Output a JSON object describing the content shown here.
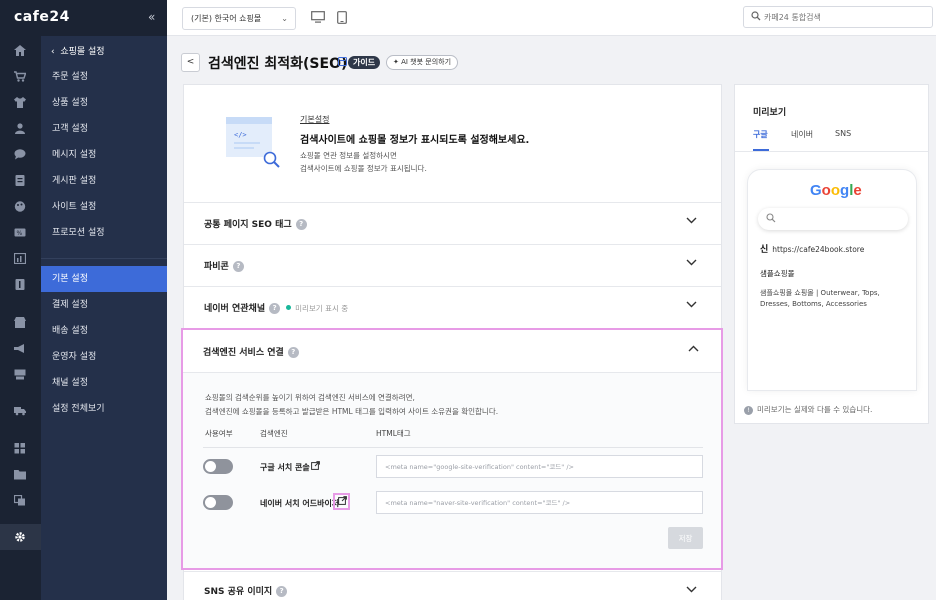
{
  "app": {
    "brand": "cafe24",
    "collapse": "«"
  },
  "menu": {
    "back_label": "쇼핑몰 설정",
    "items": [
      {
        "label": "주문 설정"
      },
      {
        "label": "상품 설정"
      },
      {
        "label": "고객 설정"
      },
      {
        "label": "메시지 설정"
      },
      {
        "label": "게시판 설정"
      },
      {
        "label": "사이트 설정"
      },
      {
        "label": "프로모션 설정"
      },
      {
        "label": "기본 설정"
      },
      {
        "label": "결제 설정"
      },
      {
        "label": "배송 설정"
      },
      {
        "label": "운영자 설정"
      },
      {
        "label": "채널 설정"
      },
      {
        "label": "설정 전체보기"
      }
    ],
    "active_index": 7
  },
  "topbar": {
    "shop_select": "(기본) 한국어 쇼핑몰",
    "search_placeholder": "카페24 통합검색"
  },
  "page": {
    "back": "<",
    "title": "검색엔진 최적화(SEO)",
    "guide_label": "가이드",
    "ai_label": "AI 챗봇 문의하기"
  },
  "intro": {
    "label": "기본설정",
    "title": "검색사이트에 쇼핑몰 정보가 표시되도록 설정해보세요.",
    "desc_line1": "쇼핑몰 연관 정보를 설정하시면",
    "desc_line2": "검색사이트에 쇼핑몰 정보가 표시됩니다."
  },
  "sections": {
    "common_seo": "공통 페이지 SEO 태그",
    "favicon": "파비콘",
    "naver_channel": "네이버 연관채널",
    "naver_channel_status": "미리보기 표시 중",
    "search_engine": "검색엔진 서비스 연결",
    "sns_image": "SNS 공유 이미지"
  },
  "search_engine": {
    "desc_line1": "쇼핑몰의 검색순위를 높이기 위하여 검색엔진 서비스에 연결하려면,",
    "desc_line2": "검색엔진에 쇼핑몰을 등록하고 발급받은 HTML 태그를 입력하여 사이트 소유권을 확인합니다.",
    "col_use": "사용여부",
    "col_engine": "검색엔진",
    "col_html": "HTML태그",
    "rows": [
      {
        "name": "구글 서치 콘솔",
        "placeholder": "<meta name=\"google-site-verification\" content=\"코드\" />",
        "enabled": false
      },
      {
        "name": "네이버 서치 어드바이저",
        "placeholder": "<meta name=\"naver-site-verification\" content=\"코드\" />",
        "enabled": false
      }
    ],
    "save_label": "저장"
  },
  "preview": {
    "title": "미리보기",
    "tabs": [
      "구글",
      "네이버",
      "SNS"
    ],
    "active_tab": 0,
    "google_logo": "Google",
    "result_icon": "신",
    "result_url": "https://cafe24book.store",
    "result_title": "샘플쇼핑몰",
    "result_desc": "샘플쇼핑몰 쇼핑몰 | Outerwear, Tops, Dresses, Bottoms, Accessories",
    "note": "미리보기는 실제와 다를 수 있습니다."
  },
  "colors": {
    "accent": "#3d6bd9",
    "sidebar_dark": "#1b2333",
    "menu_bg": "#24304a",
    "highlight": "#e79be6",
    "status_green": "#19b79a"
  }
}
